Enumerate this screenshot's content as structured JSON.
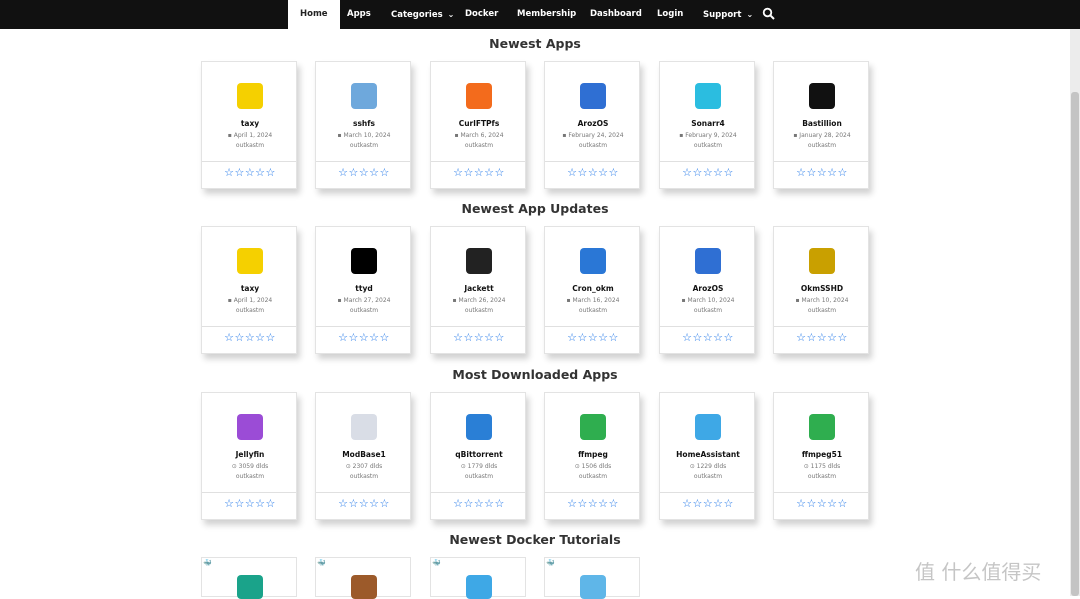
{
  "nav": {
    "home": "Home",
    "apps": "Apps",
    "categories": "Categories",
    "docker": "Docker",
    "membership": "Membership",
    "dashboard": "Dashboard",
    "login": "Login",
    "support": "Support",
    "caret": "⌄",
    "search_icon": "search-icon"
  },
  "sections": {
    "newest_apps": {
      "title": "Newest Apps",
      "cards": [
        {
          "name": "taxy",
          "meta": "April 1, 2024",
          "author": "outkastm",
          "icon": "taxy-logo-icon",
          "color": "#f5d000"
        },
        {
          "name": "sshfs",
          "meta": "March 10, 2024",
          "author": "outkastm",
          "icon": "folder-icon",
          "color": "#6ea8dc"
        },
        {
          "name": "CurlFTPfs",
          "meta": "March 6, 2024",
          "author": "outkastm",
          "icon": "ftp-folder-icon",
          "color": "#f36b1c"
        },
        {
          "name": "ArozOS",
          "meta": "February 24, 2024",
          "author": "outkastm",
          "icon": "aroz-logo-icon",
          "color": "#2f6fd3"
        },
        {
          "name": "Sonarr4",
          "meta": "February 9, 2024",
          "author": "outkastm",
          "icon": "sonarr-logo-icon",
          "color": "#2bbde0"
        },
        {
          "name": "Bastillion",
          "meta": "January 28, 2024",
          "author": "outkastm",
          "icon": "bastillion-logo-icon",
          "color": "#111111"
        }
      ]
    },
    "newest_updates": {
      "title": "Newest App Updates",
      "cards": [
        {
          "name": "taxy",
          "meta": "April 1, 2024",
          "author": "outkastm",
          "icon": "taxy-logo-icon",
          "color": "#f5d000"
        },
        {
          "name": "ttyd",
          "meta": "March 27, 2024",
          "author": "outkastm",
          "icon": "ttyd-terminal-icon",
          "color": "#000000"
        },
        {
          "name": "Jackett",
          "meta": "March 26, 2024",
          "author": "outkastm",
          "icon": "jackett-logo-icon",
          "color": "#222222"
        },
        {
          "name": "Cron_okm",
          "meta": "March 16, 2024",
          "author": "outkastm",
          "icon": "crontab-clock-icon",
          "color": "#2a77d6"
        },
        {
          "name": "ArozOS",
          "meta": "March 10, 2024",
          "author": "outkastm",
          "icon": "aroz-logo-icon",
          "color": "#2f6fd3"
        },
        {
          "name": "OkmSSHD",
          "meta": "March 10, 2024",
          "author": "outkastm",
          "icon": "okm-sshd-logo-icon",
          "color": "#c9a000"
        }
      ]
    },
    "most_downloaded": {
      "title": "Most Downloaded Apps",
      "cards": [
        {
          "name": "Jellyfin",
          "meta": "3059 dlds",
          "author": "outkastm",
          "icon": "jellyfin-logo-icon",
          "color": "#9b4cd6"
        },
        {
          "name": "ModBase1",
          "meta": "2307 dlds",
          "author": "outkastm",
          "icon": "modbase-logo-icon",
          "color": "#d9dde6"
        },
        {
          "name": "qBittorrent",
          "meta": "1779 dlds",
          "author": "outkastm",
          "icon": "qbittorrent-logo-icon",
          "color": "#2a7fd6"
        },
        {
          "name": "ffmpeg",
          "meta": "1506 dlds",
          "author": "outkastm",
          "icon": "ffmpeg-logo-icon",
          "color": "#2fae4f"
        },
        {
          "name": "HomeAssistant",
          "meta": "1229 dlds",
          "author": "outkastm",
          "icon": "home-assistant-logo-icon",
          "color": "#3ea8e6"
        },
        {
          "name": "ffmpeg51",
          "meta": "1175 dlds",
          "author": "outkastm",
          "icon": "ffmpeg-logo-icon",
          "color": "#2fae4f"
        }
      ]
    },
    "docker_tutorials": {
      "title": "Newest Docker Tutorials",
      "cards": [
        {
          "icon": "music-app-icon",
          "color": "#1aa38a"
        },
        {
          "icon": "app-thumbnail-icon",
          "color": "#9c5a2a"
        },
        {
          "icon": "home-assistant-logo-icon",
          "color": "#3ea8e6"
        },
        {
          "icon": "docker-banner-icon",
          "color": "#5fb6e8"
        }
      ]
    }
  },
  "rating_stars": "☆☆☆☆☆",
  "calendar_glyph": "▪",
  "download_glyph": "⊙",
  "docker_glyph": "🐳",
  "watermark": "值 什么值得买"
}
